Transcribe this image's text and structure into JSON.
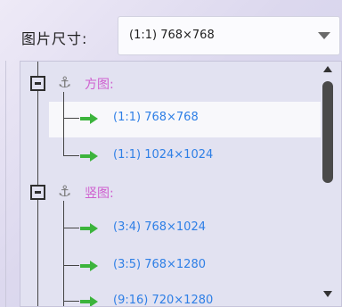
{
  "image_size": {
    "label": "图片尺寸:",
    "selected": "(1:1) 768×768"
  },
  "tree": {
    "groups": [
      {
        "label": "方图:",
        "items": [
          {
            "label": "(1:1) 768×768",
            "selected": true
          },
          {
            "label": "(1:1) 1024×1024",
            "selected": false
          }
        ]
      },
      {
        "label": "竖图:",
        "items": [
          {
            "label": "(3:4) 768×1024",
            "selected": false
          },
          {
            "label": "(3:5) 768×1280",
            "selected": false
          },
          {
            "label": "(9:16) 720×1280",
            "selected": false
          }
        ]
      }
    ]
  },
  "colors": {
    "group_label": "#cf5fcf",
    "item_label": "#2e7fe6",
    "arrow": "#3cb43c",
    "selected_row": "#f8f8fb"
  },
  "icons": {
    "collapse": "minus-box-icon",
    "group": "anchor-icon",
    "item": "green-arrow-icon",
    "dropdown": "chevron-down-icon"
  }
}
